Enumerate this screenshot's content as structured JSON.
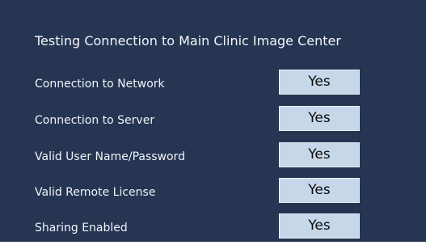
{
  "title": "Testing Connection to Main Clinic Image Center",
  "checks": [
    {
      "label": "Connection to Network",
      "value": "Yes"
    },
    {
      "label": "Connection to Server",
      "value": "Yes"
    },
    {
      "label": "Valid User Name/Password",
      "value": "Yes"
    },
    {
      "label": "Valid Remote License",
      "value": "Yes"
    },
    {
      "label": "Sharing Enabled",
      "value": "Yes"
    }
  ],
  "colors": {
    "panel_background": "#253552",
    "value_box_background": "#c7d7ea"
  }
}
